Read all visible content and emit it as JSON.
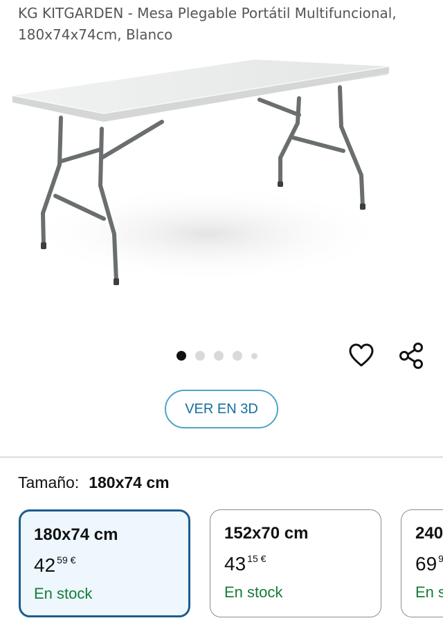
{
  "product": {
    "title": "KG KITGARDEN - Mesa Plegable Portátil Multifuncional, 180x74x74cm, Blanco"
  },
  "gallery": {
    "image_count": 5,
    "active_index": 0
  },
  "actions": {
    "wishlist_icon": "heart-icon",
    "share_icon": "share-icon",
    "view_3d_label": "VER EN 3D"
  },
  "size": {
    "label": "Tamaño:",
    "selected_value": "180x74 cm",
    "options": [
      {
        "name": "180x74 cm",
        "price_whole": "42",
        "price_fraction": "59 €",
        "stock": "En stock",
        "selected": true
      },
      {
        "name": "152x70 cm",
        "price_whole": "43",
        "price_fraction": "15 €",
        "stock": "En stock",
        "selected": false
      },
      {
        "name": "240x",
        "price_whole": "69",
        "price_fraction": "9",
        "stock": "En s",
        "selected": false
      }
    ]
  },
  "colors": {
    "accent_blue": "#136d9e",
    "selected_border": "#1b5c8f",
    "stock_green": "#167b38"
  }
}
